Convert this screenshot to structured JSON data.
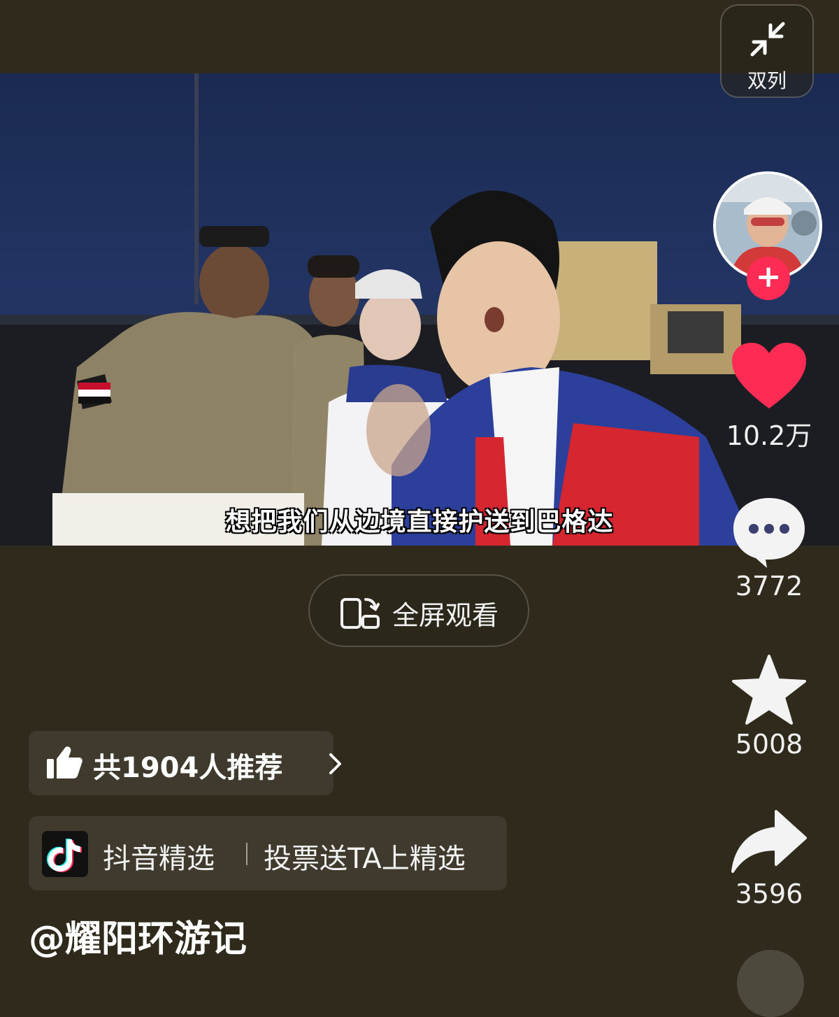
{
  "video": {
    "subtitle": "想把我们从边境直接护送到巴格达"
  },
  "layout_toggle": {
    "label": "双列",
    "icon": "collapse-arrows-icon"
  },
  "creator": {
    "follow_symbol": "+",
    "handle": "@耀阳环游记"
  },
  "actions": {
    "like_count": "10.2万",
    "comment_count": "3772",
    "favorite_count": "5008",
    "share_count": "3596"
  },
  "fullscreen": {
    "label": "全屏观看"
  },
  "recommend": {
    "label": "共1904人推荐",
    "icon": "thumbs-up-icon"
  },
  "selection": {
    "label": "抖音精选",
    "vote_label": "投票送TA上精选"
  },
  "colors": {
    "background": "#2f2a1c",
    "like": "#fe2c55",
    "follow": "#fe2c55"
  }
}
